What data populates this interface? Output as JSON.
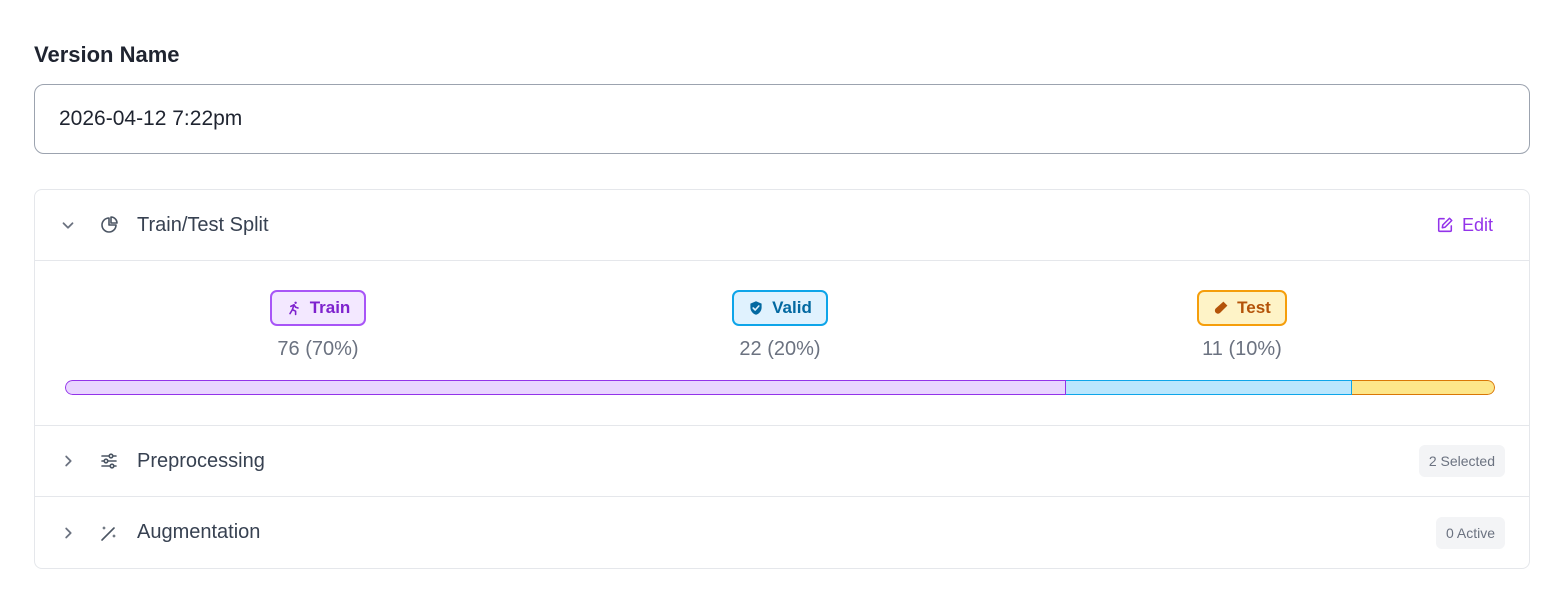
{
  "version": {
    "label": "Version Name",
    "value": "2026-04-12 7:22pm"
  },
  "sections": {
    "split": {
      "title": "Train/Test Split",
      "edit_label": "Edit",
      "icon": "pie-chart-icon",
      "expanded": true,
      "items": [
        {
          "name": "Train",
          "count": "76 (70%)",
          "fraction": 0.7,
          "icon": "running-person-icon",
          "color": "#a855f7"
        },
        {
          "name": "Valid",
          "count": "22 (20%)",
          "fraction": 0.2,
          "icon": "shield-check-icon",
          "color": "#0ea5e9"
        },
        {
          "name": "Test",
          "count": "11 (10%)",
          "fraction": 0.1,
          "icon": "test-tube-icon",
          "color": "#f59e0b"
        }
      ]
    },
    "preprocessing": {
      "title": "Preprocessing",
      "badge": "2 Selected",
      "icon": "sliders-icon",
      "expanded": false
    },
    "augmentation": {
      "title": "Augmentation",
      "badge": "0 Active",
      "icon": "magic-wand-icon",
      "expanded": false
    }
  }
}
